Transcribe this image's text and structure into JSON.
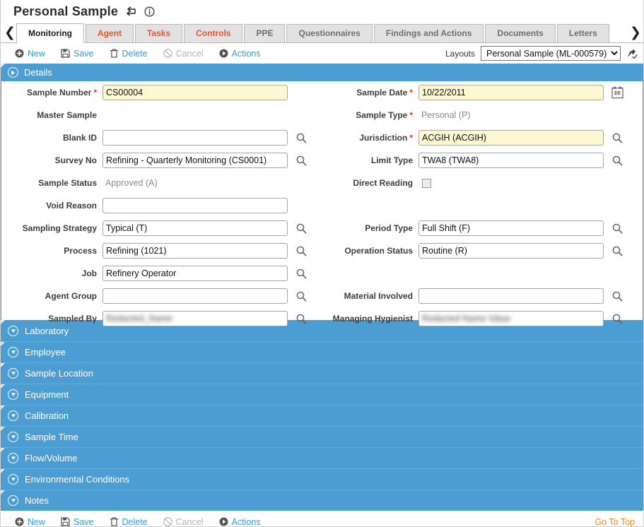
{
  "header": {
    "title": "Personal Sample",
    "back_icon": "return-arrow-icon",
    "info_icon": "info-circle-icon"
  },
  "tabs": {
    "prev_label": "❮",
    "next_label": "❯",
    "items": [
      {
        "label": "Monitoring",
        "active": true,
        "muted": false
      },
      {
        "label": "Agent",
        "active": false,
        "muted": false
      },
      {
        "label": "Tasks",
        "active": false,
        "muted": false
      },
      {
        "label": "Controls",
        "active": false,
        "muted": false
      },
      {
        "label": "PPE",
        "active": false,
        "muted": true
      },
      {
        "label": "Questionnaires",
        "active": false,
        "muted": true
      },
      {
        "label": "Findings and Actions",
        "active": false,
        "muted": true
      },
      {
        "label": "Documents",
        "active": false,
        "muted": true
      },
      {
        "label": "Letters",
        "active": false,
        "muted": true
      }
    ]
  },
  "toolbar": {
    "new_label": "New",
    "save_label": "Save",
    "delete_label": "Delete",
    "cancel_label": "Cancel",
    "actions_label": "Actions",
    "layouts_label": "Layouts",
    "layouts_value": "Personal Sample (ML-000579)",
    "layouts_options": [
      "Personal Sample (ML-000579)"
    ],
    "pin_icon": "pin-check-icon"
  },
  "details_section": {
    "title": "Details",
    "expanded": true,
    "left_fields": [
      {
        "label": "Sample Number",
        "required": true,
        "value": "CS00004",
        "type": "input",
        "highlight": true,
        "lookup": false,
        "blurred": false
      },
      {
        "label": "Master Sample",
        "required": false,
        "value": "",
        "type": "static",
        "highlight": false,
        "lookup": false,
        "blurred": false
      },
      {
        "label": "Blank ID",
        "required": false,
        "value": "",
        "type": "input",
        "highlight": false,
        "lookup": true,
        "blurred": false
      },
      {
        "label": "Survey No",
        "required": false,
        "value": "Refining - Quarterly Monitoring (CS0001)",
        "type": "input",
        "highlight": false,
        "lookup": true,
        "blurred": false
      },
      {
        "label": "Sample Status",
        "required": false,
        "value": "Approved (A)",
        "type": "static",
        "highlight": false,
        "lookup": false,
        "blurred": false
      },
      {
        "label": "Void Reason",
        "required": false,
        "value": "",
        "type": "input",
        "highlight": false,
        "lookup": false,
        "blurred": false
      },
      {
        "label": "Sampling Strategy",
        "required": false,
        "value": "Typical (T)",
        "type": "input",
        "highlight": false,
        "lookup": true,
        "blurred": false
      },
      {
        "label": "Process",
        "required": false,
        "value": "Refining (1021)",
        "type": "input",
        "highlight": false,
        "lookup": true,
        "blurred": false
      },
      {
        "label": "Job",
        "required": false,
        "value": "Refinery Operator",
        "type": "input",
        "highlight": false,
        "lookup": true,
        "blurred": false
      },
      {
        "label": "Agent Group",
        "required": false,
        "value": "",
        "type": "input",
        "highlight": false,
        "lookup": true,
        "blurred": false
      },
      {
        "label": "Sampled By",
        "required": false,
        "value": "Redacted_Name",
        "type": "input",
        "highlight": false,
        "lookup": true,
        "blurred": true
      }
    ],
    "right_fields": [
      {
        "label": "Sample Date",
        "required": true,
        "value": "10/22/2011",
        "type": "input",
        "highlight": true,
        "lookup": false,
        "calendar": true,
        "blurred": false
      },
      {
        "label": "Sample Type",
        "required": true,
        "value": "Personal (P)",
        "type": "static",
        "highlight": false,
        "lookup": false,
        "calendar": false,
        "blurred": false
      },
      {
        "label": "Jurisdiction",
        "required": true,
        "value": "ACGIH (ACGIH)",
        "type": "input",
        "highlight": true,
        "lookup": true,
        "calendar": false,
        "blurred": false
      },
      {
        "label": "Limit Type",
        "required": false,
        "value": "TWA8 (TWA8)",
        "type": "input",
        "highlight": false,
        "lookup": true,
        "calendar": false,
        "blurred": false
      },
      {
        "label": "Direct Reading",
        "required": false,
        "value": "",
        "type": "checkbox",
        "highlight": false,
        "lookup": false,
        "calendar": false,
        "blurred": false,
        "checked": false
      },
      {
        "label": "",
        "required": false,
        "value": "",
        "type": "blank",
        "highlight": false,
        "lookup": false,
        "calendar": false,
        "blurred": false
      },
      {
        "label": "Period Type",
        "required": false,
        "value": "Full Shift (F)",
        "type": "input",
        "highlight": false,
        "lookup": true,
        "calendar": false,
        "blurred": false
      },
      {
        "label": "Operation Status",
        "required": false,
        "value": "Routine (R)",
        "type": "input",
        "highlight": false,
        "lookup": true,
        "calendar": false,
        "blurred": false
      },
      {
        "label": "",
        "required": false,
        "value": "",
        "type": "blank",
        "highlight": false,
        "lookup": false,
        "calendar": false,
        "blurred": false
      },
      {
        "label": "Material Involved",
        "required": false,
        "value": "",
        "type": "input",
        "highlight": false,
        "lookup": true,
        "calendar": false,
        "blurred": false
      },
      {
        "label": "Managing Hygienist",
        "required": false,
        "value": "Redacted Name Value",
        "type": "input",
        "highlight": false,
        "lookup": true,
        "calendar": false,
        "blurred": true
      }
    ]
  },
  "collapsed_sections": [
    {
      "label": "Laboratory"
    },
    {
      "label": "Employee"
    },
    {
      "label": "Sample Location"
    },
    {
      "label": "Equipment"
    },
    {
      "label": "Calibration"
    },
    {
      "label": "Sample Time"
    },
    {
      "label": "Flow/Volume"
    },
    {
      "label": "Environmental Conditions"
    },
    {
      "label": "Notes"
    }
  ],
  "footer": {
    "new_label": "New",
    "save_label": "Save",
    "delete_label": "Delete",
    "cancel_label": "Cancel",
    "actions_label": "Actions",
    "go_to_top_label": "Go To Top"
  },
  "colors": {
    "accent_blue": "#4c9ed2",
    "link_blue": "#2e9fd4",
    "tab_orange": "#e8542a",
    "required_red": "#e03a1f",
    "required_field_bg": "#fdf8cf",
    "go_to_top_orange": "#f0892a"
  }
}
